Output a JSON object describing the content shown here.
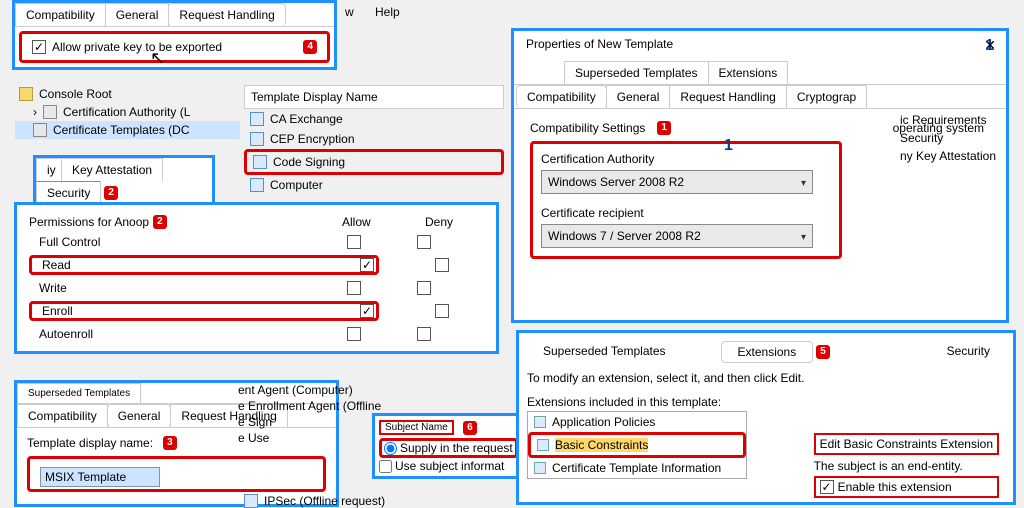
{
  "menu": {
    "w": "w",
    "help": "Help"
  },
  "top_tabs": {
    "compat": "Compatibility",
    "general": "General",
    "req": "Request Handling",
    "allow_export": "Allow private key to be exported",
    "badge": "4"
  },
  "tree": {
    "root": "Console Root",
    "ca": "Certification Authority (L",
    "ct": "Certificate Templates (DC"
  },
  "tpl_list": {
    "hdr": "Template Display Name",
    "items": [
      "CA Exchange",
      "CEP Encryption",
      "Code Signing",
      "Computer"
    ],
    "extra": [
      "ent Agent (Computer)",
      "e Enrollment Agent (Offline",
      "e Sign",
      "e Use"
    ],
    "ipsec": "IPSec (Offline request)"
  },
  "sec_tabs": {
    "iy": "iy",
    "ka": "Key Attestation",
    "security": "Security",
    "badge": "2"
  },
  "perms": {
    "title": "Permissions for Anoop",
    "badge": "2",
    "allow": "Allow",
    "deny": "Deny",
    "rows": [
      "Full Control",
      "Read",
      "Write",
      "Enroll",
      "Autoenroll"
    ]
  },
  "gen_panel": {
    "tabs": {
      "compat": "Compatibility",
      "general": "General",
      "req": "Request Handling",
      "superseded": "Superseded Templates"
    },
    "label": "Template display name:",
    "badge": "3",
    "value": "MSIX Template"
  },
  "subj": {
    "tab": "Subject Name",
    "badge": "6",
    "opt1": "Supply in the request",
    "opt2": "Use subject informat"
  },
  "props": {
    "title": "Properties of New Template",
    "badge": "1",
    "tabrow1": [
      "Superseded Templates",
      "Extensions"
    ],
    "tabrow2": [
      "Compatibility",
      "General",
      "Request Handling",
      "Cryptograp"
    ],
    "side": [
      "ic  Requirements",
      "Security",
      "ny   Key Attestation"
    ],
    "compat_section": "Compatibility Settings",
    "compat_badge": "1",
    "ca_label": "Certification Authority",
    "ca_value": "Windows Server 2008 R2",
    "cr_label": "Certificate recipient",
    "cr_value": "Windows 7 / Server 2008 R2",
    "misc1": "operating system",
    "compat_badge2": "1"
  },
  "ext": {
    "tabs": {
      "super": "Superseded Templates",
      "ext": "Extensions",
      "sec": "Security"
    },
    "badge": "5",
    "modify": "To modify an extension, select it, and then click Edit.",
    "included": "Extensions included in this template:",
    "list": [
      "Application Policies",
      "Basic Constraints",
      "Certificate Template Information"
    ],
    "edit_title": "Edit Basic Constraints Extension",
    "end_entity": "The subject is an end-entity.",
    "enable": "Enable this extension"
  }
}
